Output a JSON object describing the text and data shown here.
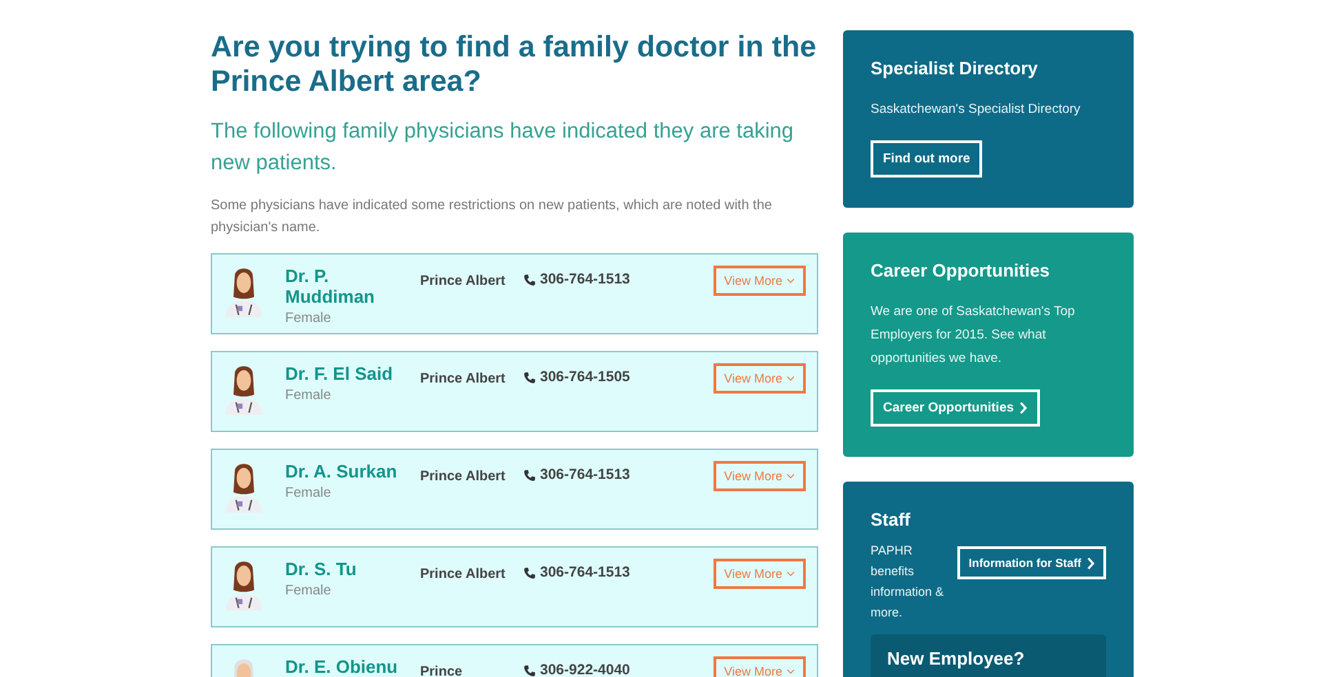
{
  "heading": "Are you trying to find a family doctor in the Prince Albert area?",
  "subheading": "The following family physicians have indicated they are taking new patients.",
  "note": "Some physicians have indicated some restrictions on new patients, which are noted with the physician's name.",
  "doctors": [
    {
      "name": "Dr. P. Muddiman",
      "gender": "Female",
      "city": "Prince Albert",
      "phone": "306-764-1513",
      "button": "View More"
    },
    {
      "name": "Dr. F. El Said",
      "gender": "Female",
      "city": "Prince Albert",
      "phone": "306-764-1505",
      "button": "View More"
    },
    {
      "name": "Dr. A. Surkan",
      "gender": "Female",
      "city": "Prince Albert",
      "phone": "306-764-1513",
      "button": "View More"
    },
    {
      "name": "Dr. S. Tu",
      "gender": "Female",
      "city": "Prince Albert",
      "phone": "306-764-1513",
      "button": "View More"
    },
    {
      "name": "Dr. E. Obienu",
      "city": "Prince",
      "phone": "306-922-4040",
      "button": "View More"
    }
  ],
  "sidebar": [
    {
      "kind": "stacked",
      "color": "#0e6b87",
      "title": "Specialist Directory",
      "text": "Saskatchewan's Specialist Directory",
      "button": "Find out more",
      "chevron": false
    },
    {
      "kind": "stacked",
      "color": "#14998a",
      "title": "Career Opportunities",
      "text": "We are one of Saskatchewan's Top Employers for 2015. See what opportunities we have.",
      "button": "Career Opportunities",
      "chevron": true
    },
    {
      "kind": "side",
      "color": "#0e6b87",
      "title": "Staff",
      "text": "PAPHR benefits information & more.",
      "button": "Information for Staff",
      "chevron": true,
      "subpanel": "New Employee?"
    }
  ]
}
